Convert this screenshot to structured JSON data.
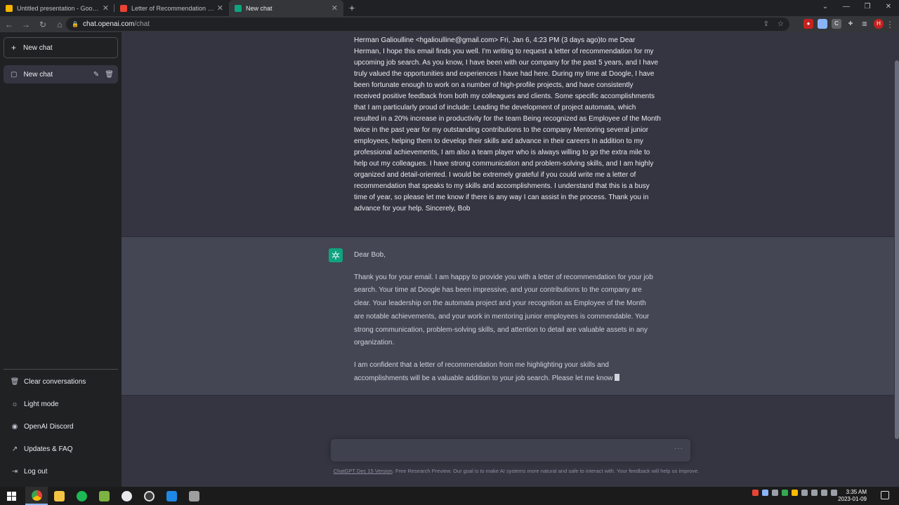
{
  "browser": {
    "tabs": [
      {
        "title": "Untitled presentation - Google Slides",
        "color": "#f4b400"
      },
      {
        "title": "Letter of Recommendation for Job Search",
        "color": "#ea4335"
      },
      {
        "title": "New chat",
        "color": "#10a37f"
      }
    ],
    "new_tab": "+",
    "url_host": "chat.openai.com",
    "url_path": "/chat",
    "profile_initial": "H"
  },
  "sidebar": {
    "new_chat": "New chat",
    "chats": [
      {
        "label": "New chat"
      }
    ],
    "links": [
      {
        "label": "Clear conversations",
        "icon": "trash-icon"
      },
      {
        "label": "Light mode",
        "icon": "sun-icon"
      },
      {
        "label": "OpenAI Discord",
        "icon": "discord-icon"
      },
      {
        "label": "Updates & FAQ",
        "icon": "external-link-icon"
      },
      {
        "label": "Log out",
        "icon": "logout-icon"
      }
    ]
  },
  "conversation": {
    "user_message": "Herman Galioulline <hgalioulline@gmail.com> Fri, Jan 6, 4:23 PM (3 days ago)to me Dear Herman, I hope this email finds you well. I'm writing to request a letter of recommendation for my upcoming job search. As you know, I have been with our company for the past 5 years, and I have truly valued the opportunities and experiences I have had here. During my time at Doogle, I have been fortunate enough to work on a number of high-profile projects, and have consistently received positive feedback from both my colleagues and clients. Some specific accomplishments that I am particularly proud of include: Leading the development of project automata, which resulted in a 20% increase in productivity for the team Being recognized as Employee of the Month twice in the past year for my outstanding contributions to the company Mentoring several junior employees, helping them to develop their skills and advance in their careers In addition to my professional achievements, I am also a team player who is always willing to go the extra mile to help out my colleagues. I have strong communication and problem-solving skills, and I am highly organized and detail-oriented. I would be extremely grateful if you could write me a letter of recommendation that speaks to my skills and accomplishments. I understand that this is a busy time of year, so please let me know if there is any way I can assist in the process. Thank you in advance for your help. Sincerely, Bob",
    "bot_paragraphs": [
      "Dear Bob,",
      "Thank you for your email. I am happy to provide you with a letter of recommendation for your job search. Your time at Doogle has been impressive, and your contributions to the company are clear. Your leadership on the automata project and your recognition as Employee of the Month are notable achievements, and your work in mentoring junior employees is commendable. Your strong communication, problem-solving skills, and attention to detail are valuable assets in any organization.",
      "I am confident that a letter of recommendation from me highlighting your skills and accomplishments will be a valuable addition to your job search. Please let me know"
    ]
  },
  "input": {
    "dots": "···"
  },
  "footer": {
    "link": "ChatGPT Dec 15 Version",
    "text": ". Free Research Preview. Our goal is to make AI systems more natural and safe to interact with. Your feedback will help us improve."
  },
  "taskbar": {
    "time": "3:35 AM",
    "date": "2023-01-09"
  },
  "colors": {
    "accent": "#10a37f",
    "sidebar_bg": "#202123",
    "main_bg": "#343541",
    "bot_bg": "#444654"
  }
}
